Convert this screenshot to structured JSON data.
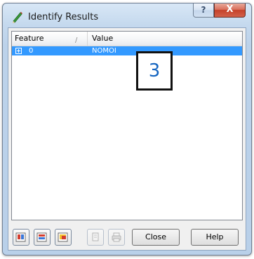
{
  "window": {
    "title": "Identify Results",
    "title_icon": "identify-pencil-icon",
    "help_glyph": "?",
    "close_glyph": "X"
  },
  "tree": {
    "columns": [
      "Feature",
      "Value"
    ],
    "sort_glyph": "/",
    "rows": [
      {
        "feature": "0",
        "value": "NOMOI",
        "expanded": false,
        "selected": true
      }
    ]
  },
  "annotation": {
    "step_number": "3"
  },
  "toolbar": {
    "icon_buttons": [
      {
        "icon": "expand-all-icon",
        "enabled": true
      },
      {
        "icon": "collapse-all-icon",
        "enabled": true
      },
      {
        "icon": "highlight-feature-icon",
        "enabled": true
      },
      {
        "icon": "copy-icon",
        "enabled": false
      },
      {
        "icon": "print-icon",
        "enabled": false
      }
    ],
    "close_label": "Close",
    "help_label": "Help"
  },
  "colors": {
    "selection": "#3399ff",
    "step_number": "#1565c0",
    "close_button": "#c5412a"
  }
}
